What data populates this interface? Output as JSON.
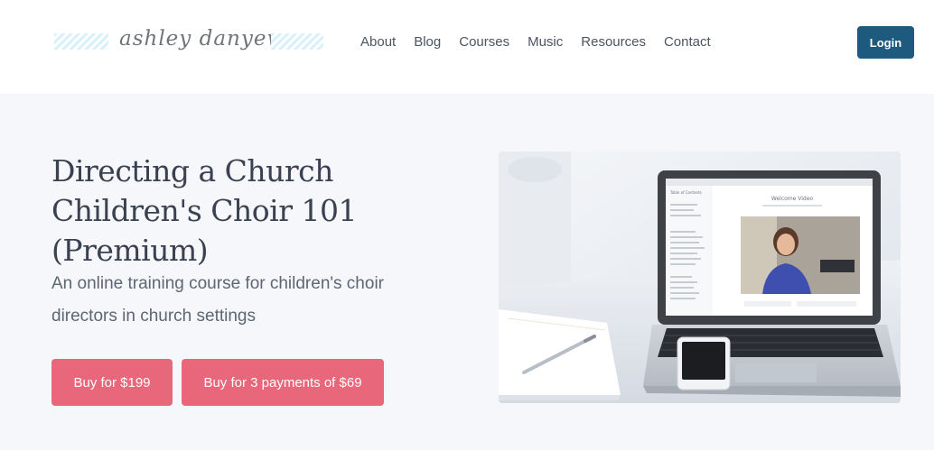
{
  "brand": {
    "logo_text": "ashley danyew"
  },
  "nav": {
    "items": [
      "About",
      "Blog",
      "Courses",
      "Music",
      "Resources",
      "Contact"
    ],
    "login_label": "Login"
  },
  "hero": {
    "title": "Directing a Church Children's Choir 101 (Premium)",
    "subtitle": "An online training course for children's choir directors in church settings",
    "buttons": [
      "Buy for $199",
      "Buy for 3 payments of $69"
    ],
    "image": {
      "laptop_video_title": "Welcome Video",
      "sidebar_heading": "Table of Contents"
    }
  },
  "colors": {
    "accent_button": "#e8677a",
    "login_button": "#1d5a7e",
    "hero_background": "#f5f7fa"
  }
}
